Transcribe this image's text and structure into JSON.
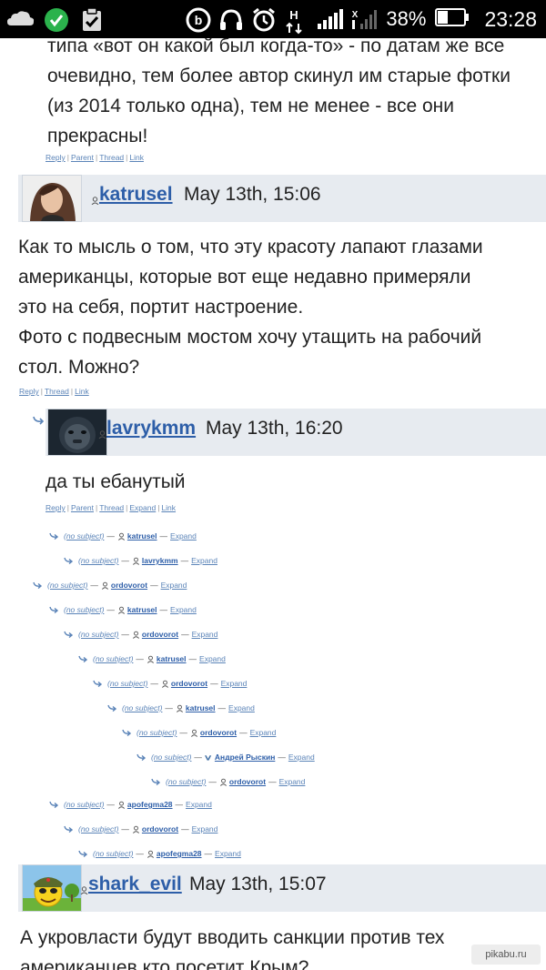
{
  "status_bar": {
    "battery_percent": "38%",
    "time": "23:28",
    "net_h": "H",
    "net_x": "X"
  },
  "comment_top": {
    "text_lines": [
      "типа «вот он какой был когда-то» - по датам же все",
      "очевидно, тем более автор скинул им старые фотки",
      "(из 2014 только одна), тем не менее - все они",
      "прекрасны!"
    ],
    "links": [
      "Reply",
      "Parent",
      "Thread",
      "Link"
    ]
  },
  "comment_katrusel": {
    "username": "katrusel",
    "date": "May 13th, 15:06",
    "text_lines": [
      "Как то мысль о том, что эту красоту лапают глазами",
      "американцы, которые вот еще недавно примеряли",
      "это на себя, портит настроение.",
      "Фото с подвесным мостом хочу утащить на рабочий",
      "стол. Можно?"
    ],
    "links": [
      "Reply",
      "Thread",
      "Link"
    ]
  },
  "comment_lavrykmm": {
    "username": "lavrykmm",
    "date": "May 13th, 16:20",
    "text": "да ты ебанутый",
    "links": [
      "Reply",
      "Parent",
      "Thread",
      "Expand",
      "Link"
    ]
  },
  "thread": {
    "subject": "(no subject)",
    "expand": "Expand",
    "rows": [
      {
        "user": "katrusel"
      },
      {
        "user": "lavrykmm"
      },
      {
        "user": "ordovorot"
      },
      {
        "user": "katrusel"
      },
      {
        "user": "ordovorot"
      },
      {
        "user": "katrusel"
      },
      {
        "user": "ordovorot"
      },
      {
        "user": "katrusel"
      },
      {
        "user": "ordovorot"
      },
      {
        "user": "Андрей Рыскин"
      },
      {
        "user": "ordovorot"
      },
      {
        "user": "apofegma28"
      },
      {
        "user": "ordovorot"
      },
      {
        "user": "apofegma28"
      }
    ]
  },
  "comment_shark": {
    "username": "shark_evil",
    "date": "May 13th, 15:07",
    "text_lines": [
      "А укровласти будут вводить санкции против тех",
      "американцев кто посетит Крым?"
    ]
  },
  "watermark": "pikabu.ru",
  "colors": {
    "link": "#5b84b8",
    "username": "#2d5ea8",
    "header_bg": "#e7ebf0",
    "statusbar_bg": "#000000"
  }
}
